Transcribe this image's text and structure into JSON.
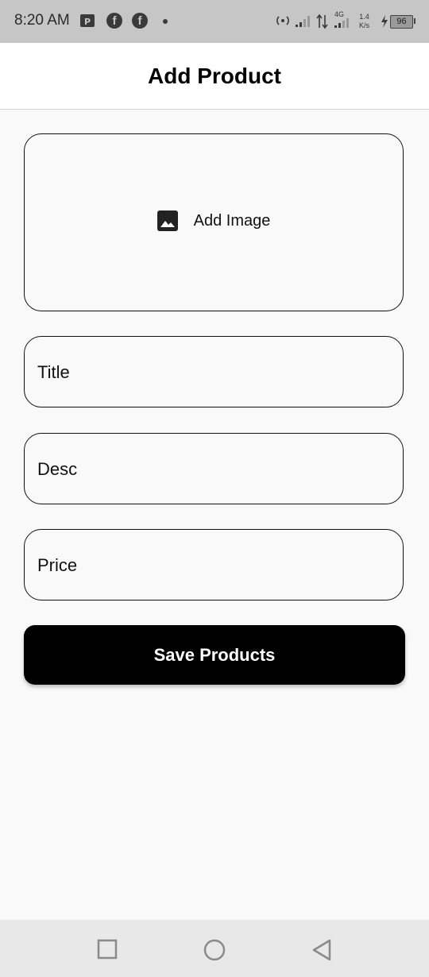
{
  "status_bar": {
    "time": "8:20 AM",
    "network_type": "4G",
    "net_speed_value": "1.4",
    "net_speed_unit": "K/s",
    "battery": "96",
    "icons": [
      "pdf-icon",
      "facebook-icon",
      "facebook-icon",
      "notification-dot-icon",
      "hotspot-icon",
      "signal-icon",
      "data-transfer-icon",
      "signal-4g-icon",
      "charging-icon",
      "battery-icon"
    ]
  },
  "app_bar": {
    "title": "Add Product"
  },
  "form": {
    "image_picker_label": "Add Image",
    "image_icon": "image-icon",
    "title_placeholder": "Title",
    "desc_placeholder": "Desc",
    "price_placeholder": "Price",
    "save_label": "Save Products"
  },
  "nav_bar": {
    "buttons": [
      "recents-square-icon",
      "home-circle-icon",
      "back-triangle-icon"
    ]
  },
  "colors": {
    "background": "#f9f9f9",
    "status_bar": "#c6c6c6",
    "app_bar": "#ffffff",
    "button": "#000000",
    "button_text": "#ffffff",
    "nav_bar": "#e8e8e8"
  }
}
